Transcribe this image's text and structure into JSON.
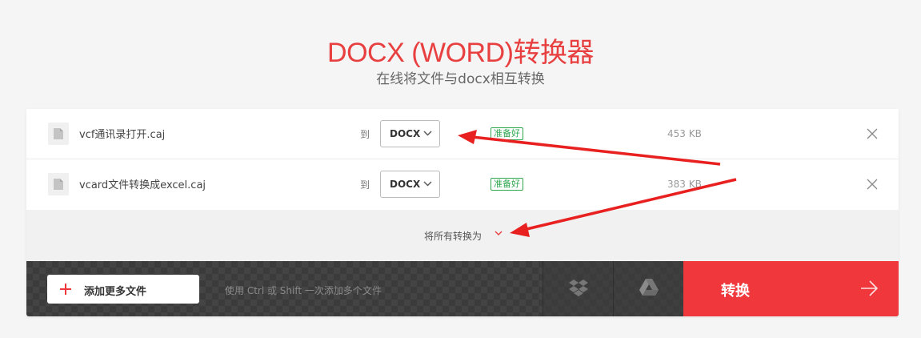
{
  "header": {
    "title": "DOCX (WORD)转换器",
    "subtitle": "在线将文件与docx相互转换"
  },
  "files": [
    {
      "name": "vcf通讯录打开.caj",
      "to_label": "到",
      "format": "DOCX",
      "status": "准备好",
      "size": "453 KB"
    },
    {
      "name": "vcard文件转换成excel.caj",
      "to_label": "到",
      "format": "DOCX",
      "status": "准备好",
      "size": "383 KB"
    }
  ],
  "convert_all": {
    "label": "将所有转换为"
  },
  "actions": {
    "add_label": "添加更多文件",
    "hint": "使用 Ctrl 或 Shift 一次添加多个文件",
    "convert_label": "转换"
  },
  "colors": {
    "brand_red": "#f0383c",
    "title_red": "#e84040",
    "ready_green": "#2fa84f",
    "annotation_red": "#e82020"
  },
  "icons": {
    "file": "file-icon",
    "dropdown": "chevron-down-icon",
    "remove": "close-icon",
    "add": "plus-icon",
    "dropbox": "dropbox-icon",
    "drive": "google-drive-icon",
    "convert": "arrow-right-icon"
  }
}
